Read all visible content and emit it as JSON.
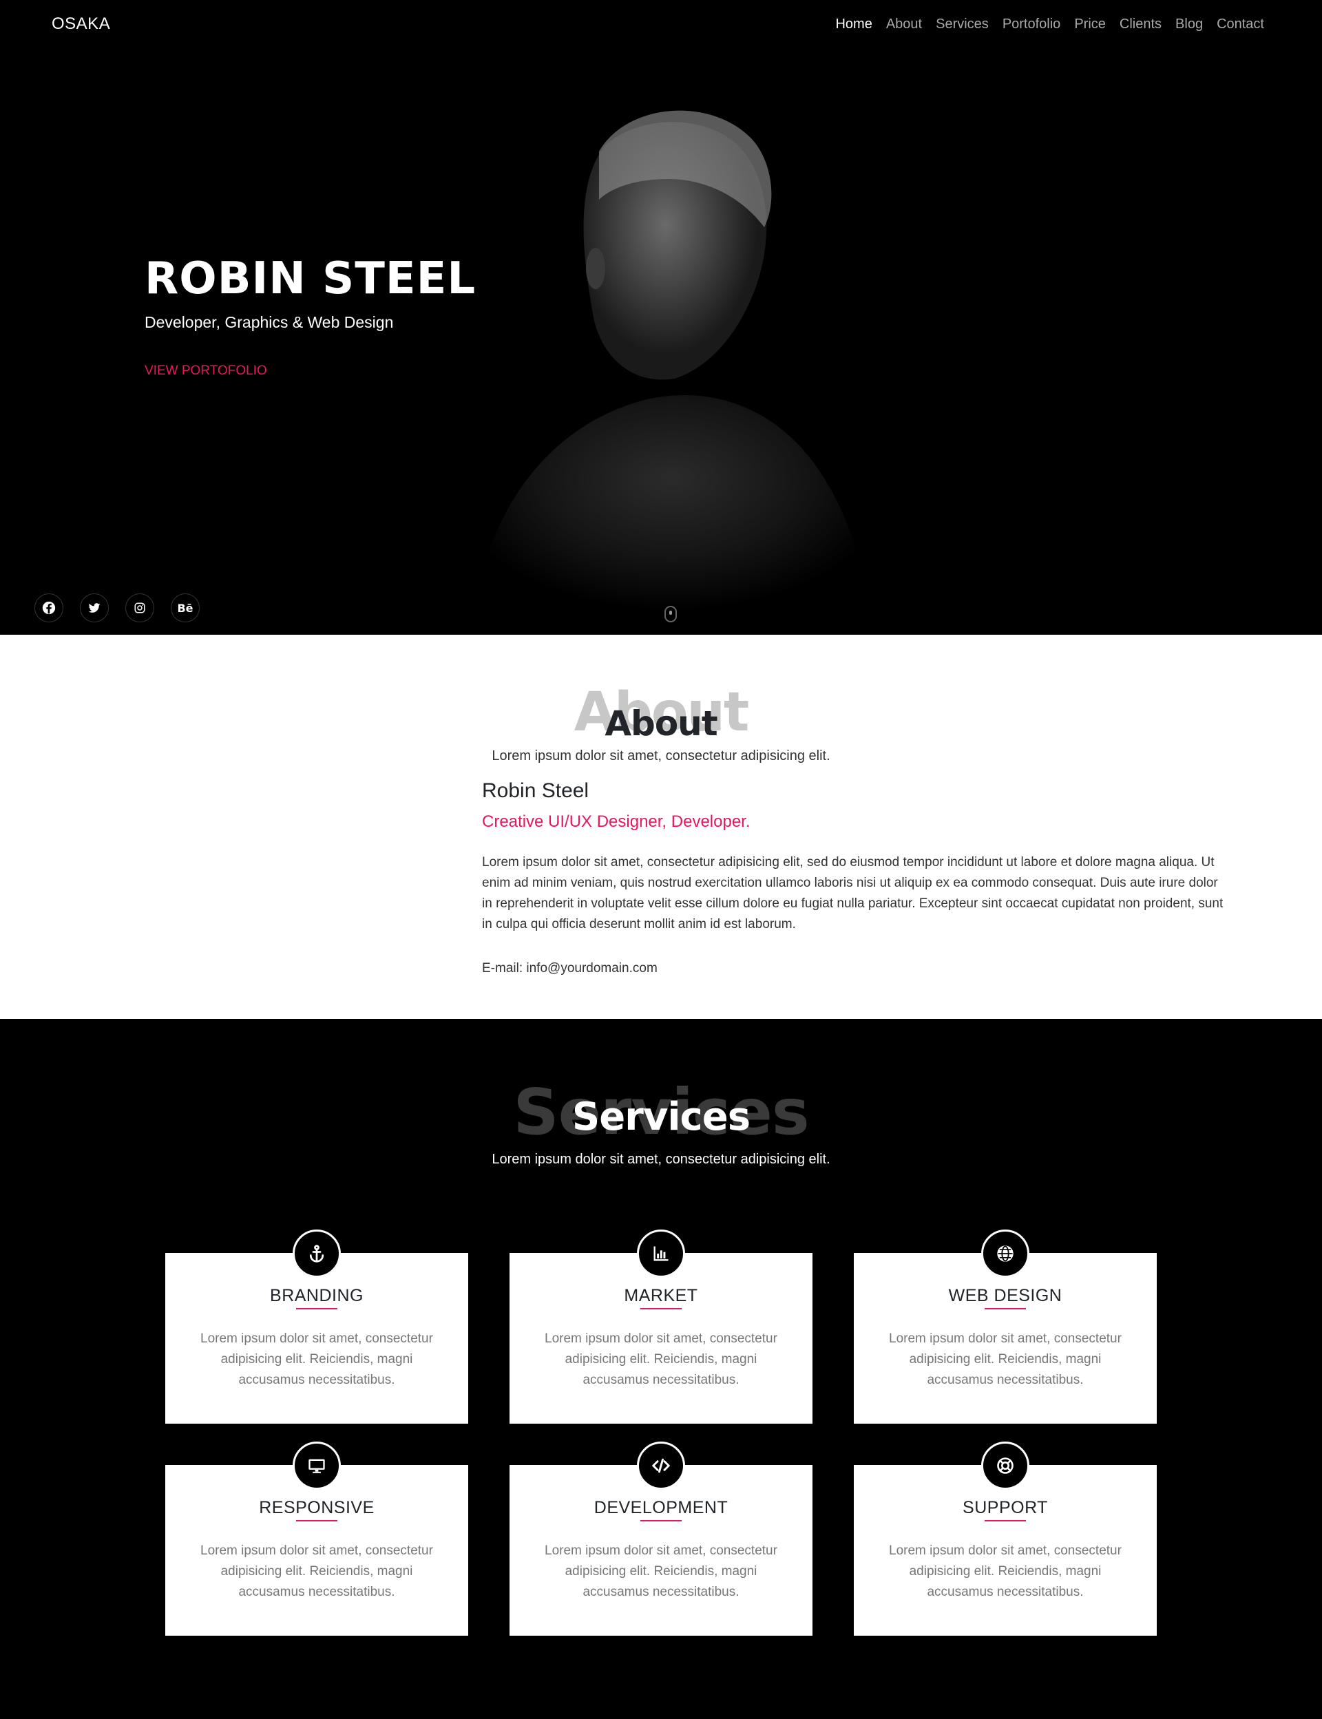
{
  "navbar": {
    "brand": "OSAKA",
    "links": [
      {
        "label": "Home",
        "active": true
      },
      {
        "label": "About"
      },
      {
        "label": "Services"
      },
      {
        "label": "Portofolio"
      },
      {
        "label": "Price"
      },
      {
        "label": "Clients"
      },
      {
        "label": "Blog"
      },
      {
        "label": "Contact"
      }
    ]
  },
  "hero": {
    "title": "ROBIN STEEL",
    "subtitle": "Developer, Graphics & Web Design",
    "cta": "VIEW PORTOFOLIO",
    "socials": [
      {
        "icon": "facebook-icon",
        "glyph": "f"
      },
      {
        "icon": "twitter-icon",
        "glyph": "t"
      },
      {
        "icon": "instagram-icon",
        "glyph": "◎"
      },
      {
        "icon": "behance-icon",
        "glyph": "Bē"
      }
    ]
  },
  "about": {
    "ghost": "About",
    "heading": "About",
    "lead": "Lorem ipsum dolor sit amet, consectetur adipisicing elit.",
    "name": "Robin Steel",
    "role": "Creative UI/UX Designer, Developer.",
    "text": "Lorem ipsum dolor sit amet, consectetur adipisicing elit, sed do eiusmod tempor incididunt ut labore et dolore magna aliqua. Ut enim ad minim veniam, quis nostrud exercitation ullamco laboris nisi ut aliquip ex ea commodo consequat. Duis aute irure dolor in reprehenderit in voluptate velit esse cillum dolore eu fugiat nulla pariatur. Excepteur sint occaecat cupidatat non proident, sunt in culpa qui officia deserunt mollit anim id est laborum.",
    "email": "E-mail: info@yourdomain.com"
  },
  "services": {
    "ghost": "Services",
    "heading": "Services",
    "lead": "Lorem ipsum dolor sit amet, consectetur adipisicing elit.",
    "items": [
      {
        "title": "BRANDING",
        "icon": "anchor-icon",
        "text": "Lorem ipsum dolor sit amet, consectetur adipisicing elit. Reiciendis, magni accusamus necessitatibus."
      },
      {
        "title": "MARKET",
        "icon": "bar-chart-icon",
        "text": "Lorem ipsum dolor sit amet, consectetur adipisicing elit. Reiciendis, magni accusamus necessitatibus."
      },
      {
        "title": "WEB DESIGN",
        "icon": "globe-icon",
        "text": "Lorem ipsum dolor sit amet, consectetur adipisicing elit. Reiciendis, magni accusamus necessitatibus."
      },
      {
        "title": "RESPONSIVE",
        "icon": "monitor-icon",
        "text": "Lorem ipsum dolor sit amet, consectetur adipisicing elit. Reiciendis, magni accusamus necessitatibus."
      },
      {
        "title": "DEVELOPMENT",
        "icon": "code-icon",
        "text": "Lorem ipsum dolor sit amet, consectetur adipisicing elit. Reiciendis, magni accusamus necessitatibus."
      },
      {
        "title": "SUPPORT",
        "icon": "lifebuoy-icon",
        "text": "Lorem ipsum dolor sit amet, consectetur adipisicing elit. Reiciendis, magni accusamus necessitatibus."
      }
    ]
  },
  "colors": {
    "accent": "#e6175c",
    "background_dark": "#000000",
    "background_light": "#ffffff"
  }
}
